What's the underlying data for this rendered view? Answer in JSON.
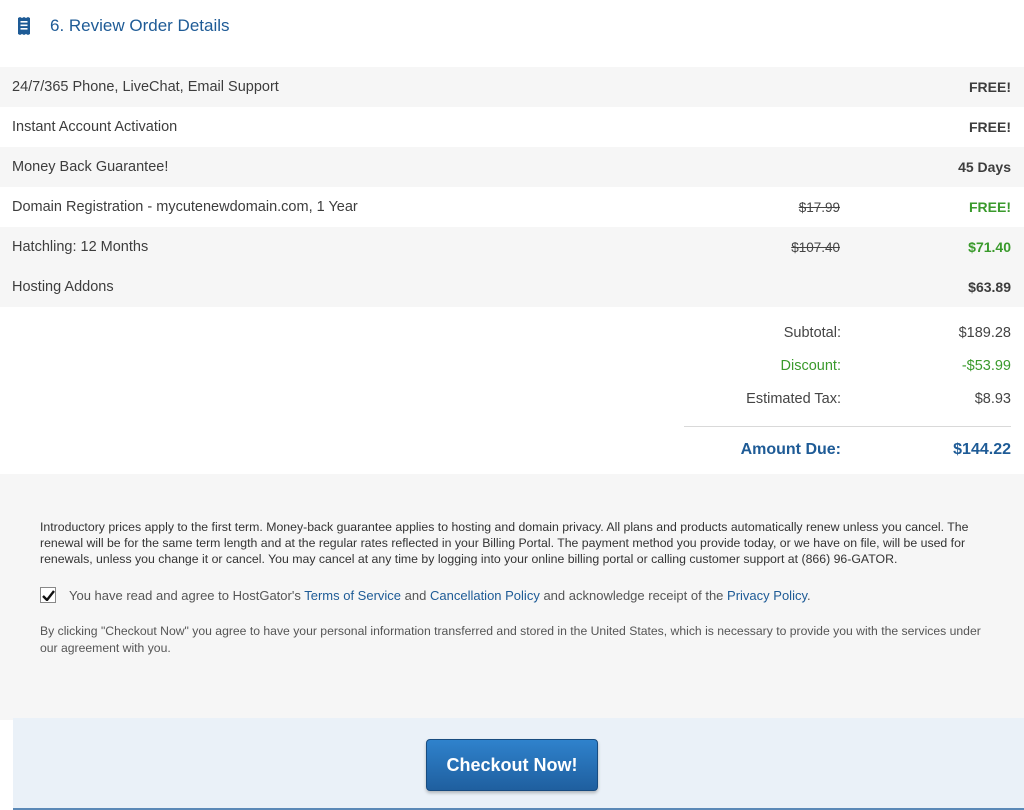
{
  "header": {
    "title": "6. Review Order Details",
    "icon": "receipt-icon"
  },
  "items": [
    {
      "label": "24/7/365 Phone, LiveChat, Email Support",
      "original": "",
      "price": "FREE!",
      "green": false
    },
    {
      "label": "Instant Account Activation",
      "original": "",
      "price": "FREE!",
      "green": false
    },
    {
      "label": "Money Back Guarantee!",
      "original": "",
      "price": "45 Days",
      "green": false
    },
    {
      "label": "Domain Registration - mycutenewdomain.com, 1 Year",
      "original": "$17.99",
      "price": "FREE!",
      "green": true
    },
    {
      "label": "Hatchling: 12 Months",
      "original": "$107.40",
      "price": "$71.40",
      "green": true
    },
    {
      "label": "Hosting Addons",
      "original": "",
      "price": "$63.89",
      "green": false
    }
  ],
  "totals": {
    "subtotal_label": "Subtotal:",
    "subtotal": "$189.28",
    "discount_label": "Discount:",
    "discount": "-$53.99",
    "tax_label": "Estimated Tax:",
    "tax": "$8.93",
    "due_label": "Amount Due:",
    "due": "$144.22"
  },
  "legal": {
    "intro": "Introductory prices apply to the first term. Money-back guarantee applies to hosting and domain privacy. All plans and products automatically renew unless you cancel. The renewal will be for the same term length and at the regular rates reflected in your Billing Portal. The payment method you provide today, or we have on file, will be used for renewals, unless you change it or cancel. You may cancel at any time by logging into your online billing portal or calling customer support at (866) 96-GATOR.",
    "agree_prefix": "You have read and agree to HostGator's",
    "tos_link": "Terms of Service",
    "and": "and",
    "cancel_link": "Cancellation Policy",
    "agree_mid": "and acknowledge receipt of the",
    "privacy_link": "Privacy Policy",
    "agree_end": ".",
    "checked": true,
    "consent": "By clicking \"Checkout Now\" you agree to have your personal information transferred and stored in the United States, which is necessary to provide you with the services under our agreement with you."
  },
  "checkout": {
    "label": "Checkout Now!"
  },
  "colors": {
    "accent": "#1e5b96",
    "green": "#3a9a2c",
    "button": "#2a74bb"
  }
}
